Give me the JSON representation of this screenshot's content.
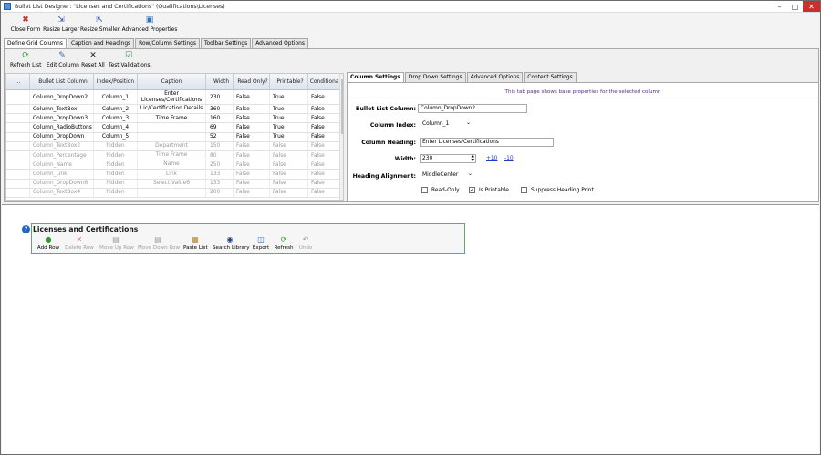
{
  "window": {
    "title": "Bullet List Designer: \"Licenses and Certifications\" (Qualifications\\Licenses)"
  },
  "ribbon": {
    "buttons": [
      {
        "label": "Close Form",
        "icon": "close-x-icon"
      },
      {
        "label": "Resize Larger",
        "icon": "resize-larger-icon"
      },
      {
        "label": "Resize Smaller",
        "icon": "resize-smaller-icon"
      },
      {
        "label": "Advanced Properties",
        "icon": "advanced-properties-icon"
      }
    ]
  },
  "main_tabs": [
    {
      "label": "Define Grid Columns"
    },
    {
      "label": "Caption and Headings"
    },
    {
      "label": "Row/Column Settings"
    },
    {
      "label": "Toolbar Settings"
    },
    {
      "label": "Advanced Options"
    }
  ],
  "toolbar": {
    "buttons": [
      {
        "label": "Refresh List"
      },
      {
        "label": "Edit Column"
      },
      {
        "label": "Reset All"
      },
      {
        "label": "Test Validations"
      }
    ]
  },
  "grid": {
    "headers": [
      "...",
      "Bullet List Column",
      "Index/Position",
      "Caption",
      "Width",
      "Read Only?",
      "Printable?",
      "Conditional?"
    ],
    "rows": [
      {
        "col": "Column_DropDown2",
        "index": "Column_1",
        "caption": "Enter Licenses/Certifications",
        "width": "230",
        "readonly": "False",
        "printable": "True",
        "conditional": "False",
        "hidden": false,
        "selected": true
      },
      {
        "col": "Column_TextBox",
        "index": "Column_2",
        "caption": "Lic/Certification Details",
        "width": "360",
        "readonly": "False",
        "printable": "True",
        "conditional": "False",
        "hidden": false
      },
      {
        "col": "Column_DropDown3",
        "index": "Column_3",
        "caption": "Time Frame",
        "width": "160",
        "readonly": "False",
        "printable": "True",
        "conditional": "False",
        "hidden": false
      },
      {
        "col": "Column_RadioButtons",
        "index": "Column_4",
        "caption": "",
        "width": "69",
        "readonly": "False",
        "printable": "True",
        "conditional": "False",
        "hidden": false
      },
      {
        "col": "Column_DropDown",
        "index": "Column_5",
        "caption": "",
        "width": "52",
        "readonly": "False",
        "printable": "True",
        "conditional": "False",
        "hidden": false
      },
      {
        "col": "Column_TextBox2",
        "index": "hidden",
        "caption": "Department",
        "width": "150",
        "readonly": "False",
        "printable": "False",
        "conditional": "False",
        "hidden": true
      },
      {
        "col": "Column_Percentage",
        "index": "hidden",
        "caption": "Time Frame",
        "width": "80",
        "readonly": "False",
        "printable": "False",
        "conditional": "False",
        "hidden": true
      },
      {
        "col": "Column_Name",
        "index": "hidden",
        "caption": "Name",
        "width": "250",
        "readonly": "False",
        "printable": "False",
        "conditional": "False",
        "hidden": true
      },
      {
        "col": "Column_Link",
        "index": "hidden",
        "caption": "Link",
        "width": "133",
        "readonly": "False",
        "printable": "False",
        "conditional": "False",
        "hidden": true
      },
      {
        "col": "Column_DropDown6",
        "index": "hidden",
        "caption": "Select Value6",
        "width": "133",
        "readonly": "False",
        "printable": "False",
        "conditional": "False",
        "hidden": true
      },
      {
        "col": "Column_TextBox4",
        "index": "hidden",
        "caption": "",
        "width": "200",
        "readonly": "False",
        "printable": "False",
        "conditional": "False",
        "hidden": true
      }
    ]
  },
  "settings_tabs": [
    {
      "label": "Column Settings"
    },
    {
      "label": "Drop Down Settings"
    },
    {
      "label": "Advanced Options"
    },
    {
      "label": "Content Settings"
    }
  ],
  "column_settings": {
    "hint": "This tab page shows base properties for the selected column",
    "bullet_list_column_label": "Bullet List Column:",
    "bullet_list_column_value": "Column_DropDown2",
    "column_index_label": "Column Index:",
    "column_index_value": "Column_1",
    "column_heading_label": "Column Heading:",
    "column_heading_value": "Enter Licenses/Certifications",
    "width_label": "Width:",
    "width_value": "230",
    "width_plus": "+10",
    "width_minus": "-10",
    "heading_alignment_label": "Heading Alignment:",
    "heading_alignment_value": "MiddleCenter",
    "read_only_label": "Read-Only",
    "is_printable_label": "Is Printable",
    "suppress_heading_label": "Suppress Heading Print"
  },
  "preview": {
    "title": "Licenses and Certifications",
    "help_glyph": "?",
    "buttons": [
      {
        "label": "Add Row",
        "disabled": false
      },
      {
        "label": "Delete Row",
        "disabled": true
      },
      {
        "label": "Move Up Row",
        "disabled": true
      },
      {
        "label": "Move Down Row",
        "disabled": true
      },
      {
        "label": "Paste List",
        "disabled": false
      },
      {
        "label": "Search Library",
        "disabled": false
      },
      {
        "label": "Export",
        "disabled": false
      },
      {
        "label": "Refresh",
        "disabled": false
      },
      {
        "label": "Undo",
        "disabled": true
      }
    ]
  }
}
